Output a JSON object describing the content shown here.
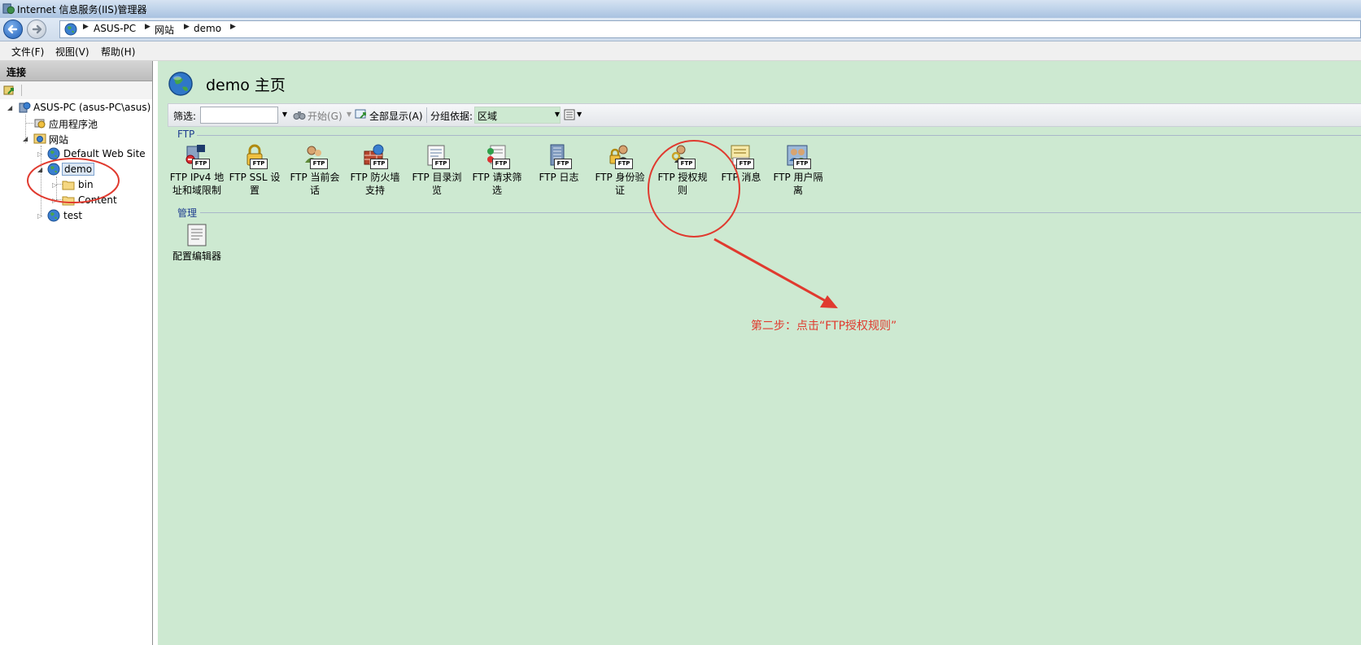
{
  "window": {
    "title": "Internet 信息服务(IIS)管理器"
  },
  "address": {
    "crumbs": [
      "ASUS-PC",
      "网站",
      "demo"
    ]
  },
  "menu": [
    "文件(F)",
    "视图(V)",
    "帮助(H)"
  ],
  "left_pane": {
    "header": "连接",
    "tree": {
      "server": "ASUS-PC (asus-PC\\asus)",
      "app_pools": "应用程序池",
      "sites": "网站",
      "default_site": "Default Web Site",
      "demo": "demo",
      "bin": "bin",
      "content": "Content",
      "test": "test"
    }
  },
  "main": {
    "title": "demo 主页",
    "filter": {
      "label": "筛选:",
      "value": "",
      "start": "开始(G)",
      "show_all": "全部显示(A)",
      "group_by_label": "分组依据:",
      "group_by_value": "区域"
    },
    "sections": [
      {
        "name": "FTP"
      },
      {
        "name": "管理"
      }
    ],
    "ftp_features": [
      {
        "line1": "FTP IPv4 地",
        "line2": "址和域限制",
        "icon": "ftp-ip-restrictions-icon"
      },
      {
        "line1": "FTP SSL 设",
        "line2": "置",
        "icon": "ftp-ssl-icon"
      },
      {
        "line1": "FTP 当前会",
        "line2": "话",
        "icon": "ftp-sessions-icon"
      },
      {
        "line1": "FTP 防火墙",
        "line2": "支持",
        "icon": "ftp-firewall-icon"
      },
      {
        "line1": "FTP 目录浏",
        "line2": "览",
        "icon": "ftp-directory-browsing-icon"
      },
      {
        "line1": "FTP 请求筛",
        "line2": "选",
        "icon": "ftp-request-filtering-icon"
      },
      {
        "line1": "FTP 日志",
        "line2": "",
        "icon": "ftp-logging-icon"
      },
      {
        "line1": "FTP 身份验",
        "line2": "证",
        "icon": "ftp-authentication-icon"
      },
      {
        "line1": "FTP 授权规",
        "line2": "则",
        "icon": "ftp-authorization-rules-icon"
      },
      {
        "line1": "FTP 消息",
        "line2": "",
        "icon": "ftp-messages-icon"
      },
      {
        "line1": "FTP 用户隔",
        "line2": "离",
        "icon": "ftp-user-isolation-icon"
      }
    ],
    "management_features": [
      {
        "line1": "配置编辑器",
        "icon": "configuration-editor-icon"
      }
    ],
    "annotation": "第二步：点击“FTP授权规则”",
    "annotation_color": "#e03a2f"
  }
}
